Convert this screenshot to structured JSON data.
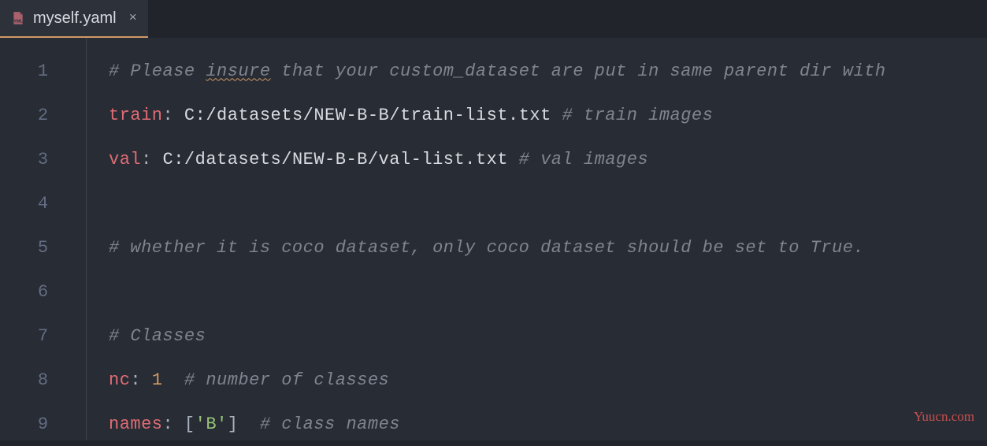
{
  "tab": {
    "filename": "myself.yaml",
    "close_symbol": "×"
  },
  "gutter": {
    "line_numbers": [
      "1",
      "2",
      "3",
      "4",
      "5",
      "6",
      "7",
      "8",
      "9"
    ]
  },
  "code": {
    "l1": {
      "c_prefix": "# Please ",
      "c_squiggle": "insure",
      "c_rest": " that your custom_dataset are put in same parent dir with "
    },
    "l2": {
      "key": "train",
      "colon": ":",
      "sp": " ",
      "value": "C:/datasets/NEW-B-B/train-list.txt",
      "comment": " # train images"
    },
    "l3": {
      "key": "val",
      "colon": ":",
      "sp": " ",
      "value": "C:/datasets/NEW-B-B/val-list.txt",
      "comment": " # val images"
    },
    "l5": {
      "comment": "# whether it is coco dataset, only coco dataset should be set to True."
    },
    "l7": {
      "comment": "# Classes"
    },
    "l8": {
      "key": "nc",
      "colon": ":",
      "sp": " ",
      "value": "1",
      "comment": "  # number of classes"
    },
    "l9": {
      "key": "names",
      "colon": ":",
      "sp": " ",
      "lb": "[",
      "item": "'B'",
      "rb": "]",
      "comment": "  # class names"
    }
  },
  "watermark": "Yuucn.com"
}
